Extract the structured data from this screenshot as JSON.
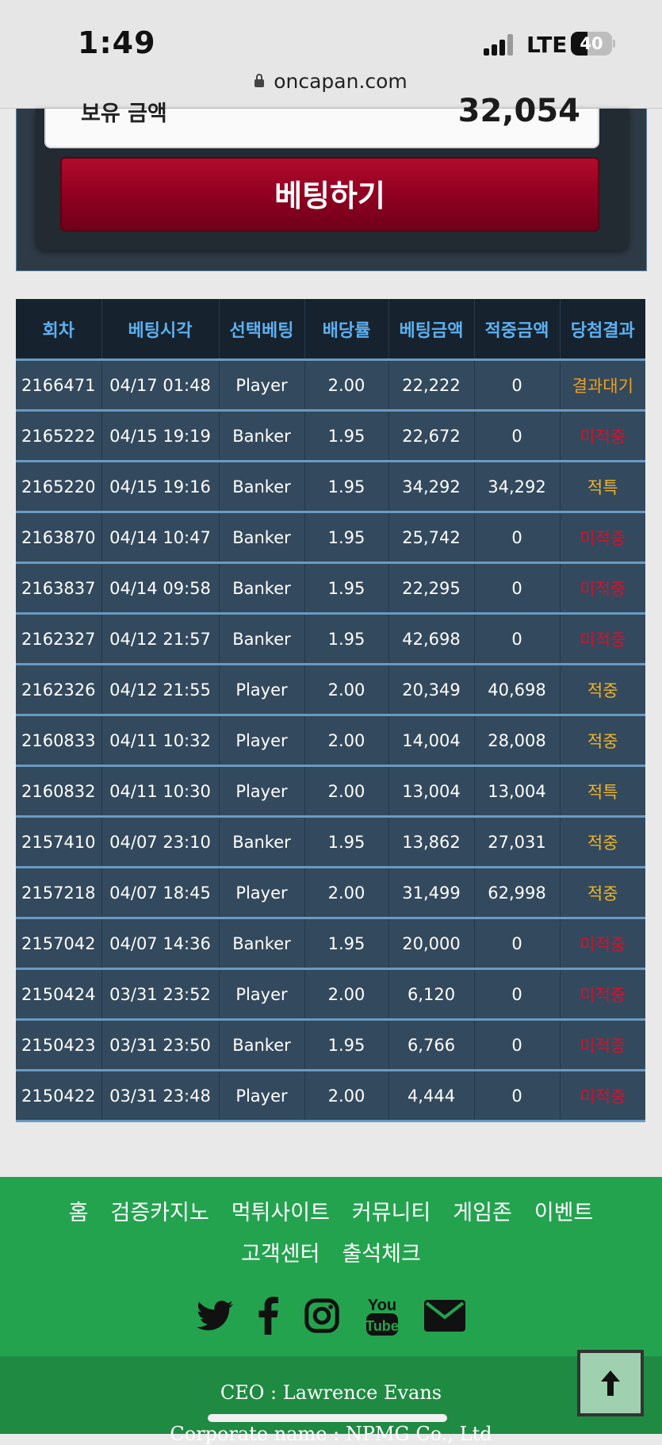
{
  "status_bar": {
    "time": "1:49",
    "network": "LTE",
    "battery": "40",
    "url": "oncapan.com"
  },
  "betting": {
    "amount_label": "보유 금액",
    "amount_value": "32,054",
    "bet_button": "베팅하기"
  },
  "table": {
    "headers": [
      "회차",
      "베팅시각",
      "선택베팅",
      "배당률",
      "베팅금액",
      "적중금액",
      "당첨결과"
    ],
    "rows": [
      [
        "2166471",
        "04/17 01:48",
        "Player",
        "2.00",
        "22,222",
        "0",
        "결과대기"
      ],
      [
        "2165222",
        "04/15 19:19",
        "Banker",
        "1.95",
        "22,672",
        "0",
        "미적중"
      ],
      [
        "2165220",
        "04/15 19:16",
        "Banker",
        "1.95",
        "34,292",
        "34,292",
        "적특"
      ],
      [
        "2163870",
        "04/14 10:47",
        "Banker",
        "1.95",
        "25,742",
        "0",
        "미적중"
      ],
      [
        "2163837",
        "04/14 09:58",
        "Banker",
        "1.95",
        "22,295",
        "0",
        "미적중"
      ],
      [
        "2162327",
        "04/12 21:57",
        "Banker",
        "1.95",
        "42,698",
        "0",
        "미적중"
      ],
      [
        "2162326",
        "04/12 21:55",
        "Player",
        "2.00",
        "20,349",
        "40,698",
        "적중"
      ],
      [
        "2160833",
        "04/11 10:32",
        "Player",
        "2.00",
        "14,004",
        "28,008",
        "적중"
      ],
      [
        "2160832",
        "04/11 10:30",
        "Player",
        "2.00",
        "13,004",
        "13,004",
        "적특"
      ],
      [
        "2157410",
        "04/07 23:10",
        "Banker",
        "1.95",
        "13,862",
        "27,031",
        "적중"
      ],
      [
        "2157218",
        "04/07 18:45",
        "Player",
        "2.00",
        "31,499",
        "62,998",
        "적중"
      ],
      [
        "2157042",
        "04/07 14:36",
        "Banker",
        "1.95",
        "20,000",
        "0",
        "미적중"
      ],
      [
        "2150424",
        "03/31 23:52",
        "Player",
        "2.00",
        "6,120",
        "0",
        "미적중"
      ],
      [
        "2150423",
        "03/31 23:50",
        "Banker",
        "1.95",
        "6,766",
        "0",
        "미적중"
      ],
      [
        "2150422",
        "03/31 23:48",
        "Player",
        "2.00",
        "4,444",
        "0",
        "미적중"
      ]
    ]
  },
  "footer": {
    "nav": [
      "홈",
      "검증카지노",
      "먹튀사이트",
      "커뮤니티",
      "게임존",
      "이벤트",
      "고객센터",
      "출석체크"
    ],
    "socials": [
      "twitter-icon",
      "facebook-icon",
      "instagram-icon",
      "youtube-icon",
      "email-icon"
    ],
    "ceo": "CEO : Lawrence Evans",
    "corporate": "Corporate name : NPMG Co., Ltd"
  },
  "colors": {
    "header_text": "#5db0f0",
    "result_wait": "#f0a020",
    "result_miss": "#d8102a",
    "result_hit": "#f0b528",
    "footer_green": "#24a34f",
    "bet_button": "#9a0022"
  }
}
